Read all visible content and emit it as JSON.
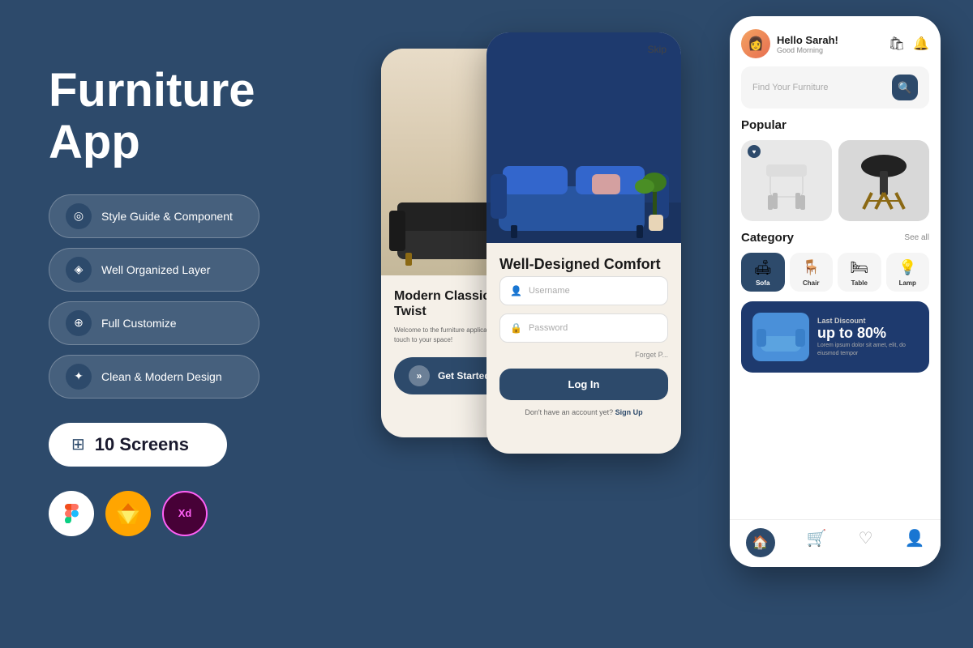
{
  "background_color": "#2d4a6b",
  "left": {
    "title_line1": "Furniture",
    "title_line2": "App",
    "features": [
      {
        "id": "style-guide",
        "label": "Style Guide & Component",
        "icon": "◎"
      },
      {
        "id": "well-organized",
        "label": "Well Organized Layer",
        "icon": "◈"
      },
      {
        "id": "full-customize",
        "label": "Full Customize",
        "icon": "⊕"
      },
      {
        "id": "clean-modern",
        "label": "Clean & Modern Design",
        "icon": "✦"
      }
    ],
    "screens": {
      "icon": "⊞",
      "label": "10 Screens"
    },
    "tools": [
      {
        "name": "Figma",
        "symbol": "✦",
        "bg": "#ffffff",
        "color": "#f24e1e"
      },
      {
        "name": "Sketch",
        "symbol": "◆",
        "bg": "#ffa500",
        "color": "#ffffff"
      },
      {
        "name": "XD",
        "symbol": "Xd",
        "bg": "#ff61f6",
        "color": "#ffffff"
      }
    ]
  },
  "phone1": {
    "title": "Modern Classics in Every Twist",
    "desc": "Welcome to the furniture application that brings elegant touch to your space!",
    "cta": "Get Started"
  },
  "phone2": {
    "skip": "Skip",
    "title": "Well-Designed Comfort",
    "login_title": "Username",
    "password_title": "Password",
    "forget": "Forget P...",
    "login_btn": "Log In",
    "signup_text": "Don't have an account yet?",
    "signup_link": "Sign Up"
  },
  "phone3": {
    "greeting": "Hello Sarah!",
    "sub_greeting": "Good Morning",
    "search_placeholder": "Find Your Furniture",
    "popular_title": "Popular",
    "category_title": "Category",
    "see_all": "See all",
    "categories": [
      {
        "label": "Sofa",
        "icon": "🛋",
        "active": true
      },
      {
        "label": "Chair",
        "icon": "🪑",
        "active": false
      },
      {
        "label": "Table",
        "icon": "🪑",
        "active": false
      },
      {
        "label": "Lamp",
        "icon": "💡",
        "active": false
      }
    ],
    "discount": {
      "subtitle": "Last Discount",
      "percent": "up to 80%",
      "desc": "Lorem ipsum dolor sit amet, elit, do eiusmod tempor"
    }
  }
}
